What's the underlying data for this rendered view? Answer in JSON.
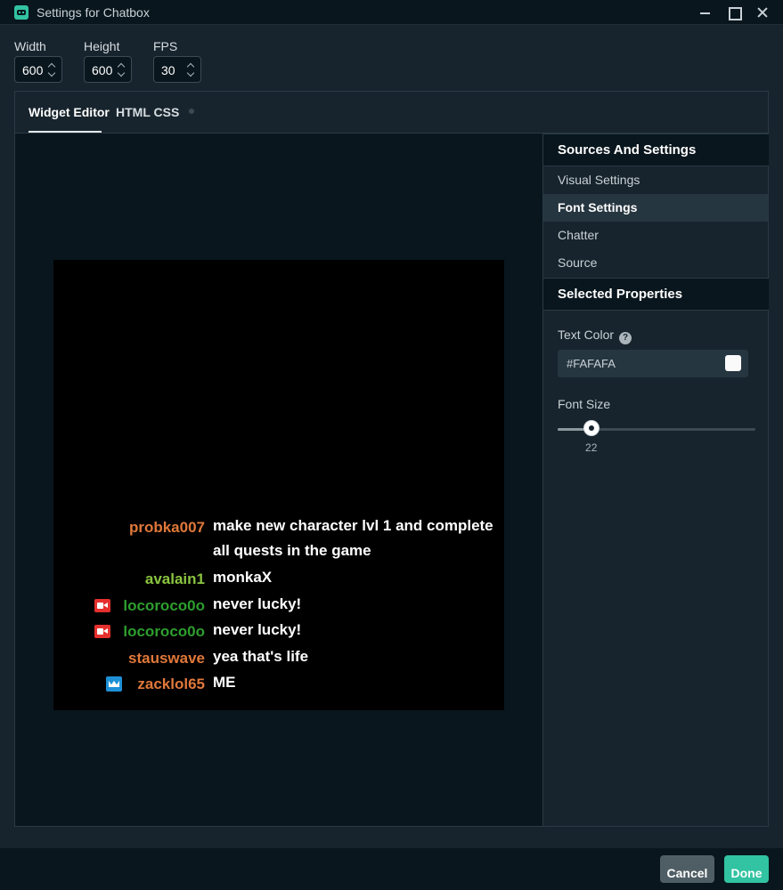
{
  "window": {
    "title": "Settings for Chatbox"
  },
  "dimensions": {
    "width": {
      "label": "Width",
      "value": "600"
    },
    "height": {
      "label": "Height",
      "value": "600"
    },
    "fps": {
      "label": "FPS",
      "value": "30"
    }
  },
  "tabs": [
    {
      "label": "Widget Editor",
      "active": true
    },
    {
      "label": "HTML CSS",
      "active": false
    }
  ],
  "chat": [
    {
      "name": "probka007",
      "name_color": "#e0783a",
      "badge": null,
      "message": "make new character lvl 1 and complete all quests in the game"
    },
    {
      "name": "avalain1",
      "name_color": "#8ac43f",
      "badge": null,
      "message": "monkaX"
    },
    {
      "name": "locoroco0o",
      "name_color": "#2e9e2e",
      "badge": "camera-badge-icon",
      "message": "never lucky!"
    },
    {
      "name": "locoroco0o",
      "name_color": "#2e9e2e",
      "badge": "camera-badge-icon",
      "message": "never lucky!"
    },
    {
      "name": "stauswave",
      "name_color": "#e0783a",
      "badge": null,
      "message": "yea that's life"
    },
    {
      "name": "zacklol65",
      "name_color": "#e0783a",
      "badge": "crown-badge-icon",
      "message": "ME"
    }
  ],
  "sidebar": {
    "sources_heading": "Sources And Settings",
    "items": [
      {
        "label": "Visual Settings",
        "active": false
      },
      {
        "label": "Font Settings",
        "active": true
      },
      {
        "label": "Chatter",
        "active": false
      },
      {
        "label": "Source",
        "active": false
      }
    ],
    "properties_heading": "Selected Properties",
    "text_color": {
      "label": "Text Color",
      "value": "#FAFAFA",
      "swatch": "#fafafa"
    },
    "font_size": {
      "label": "Font Size",
      "value": "22",
      "fraction": 0.17
    }
  },
  "footer": {
    "cancel_label": "Cancel",
    "done_label": "Done"
  }
}
